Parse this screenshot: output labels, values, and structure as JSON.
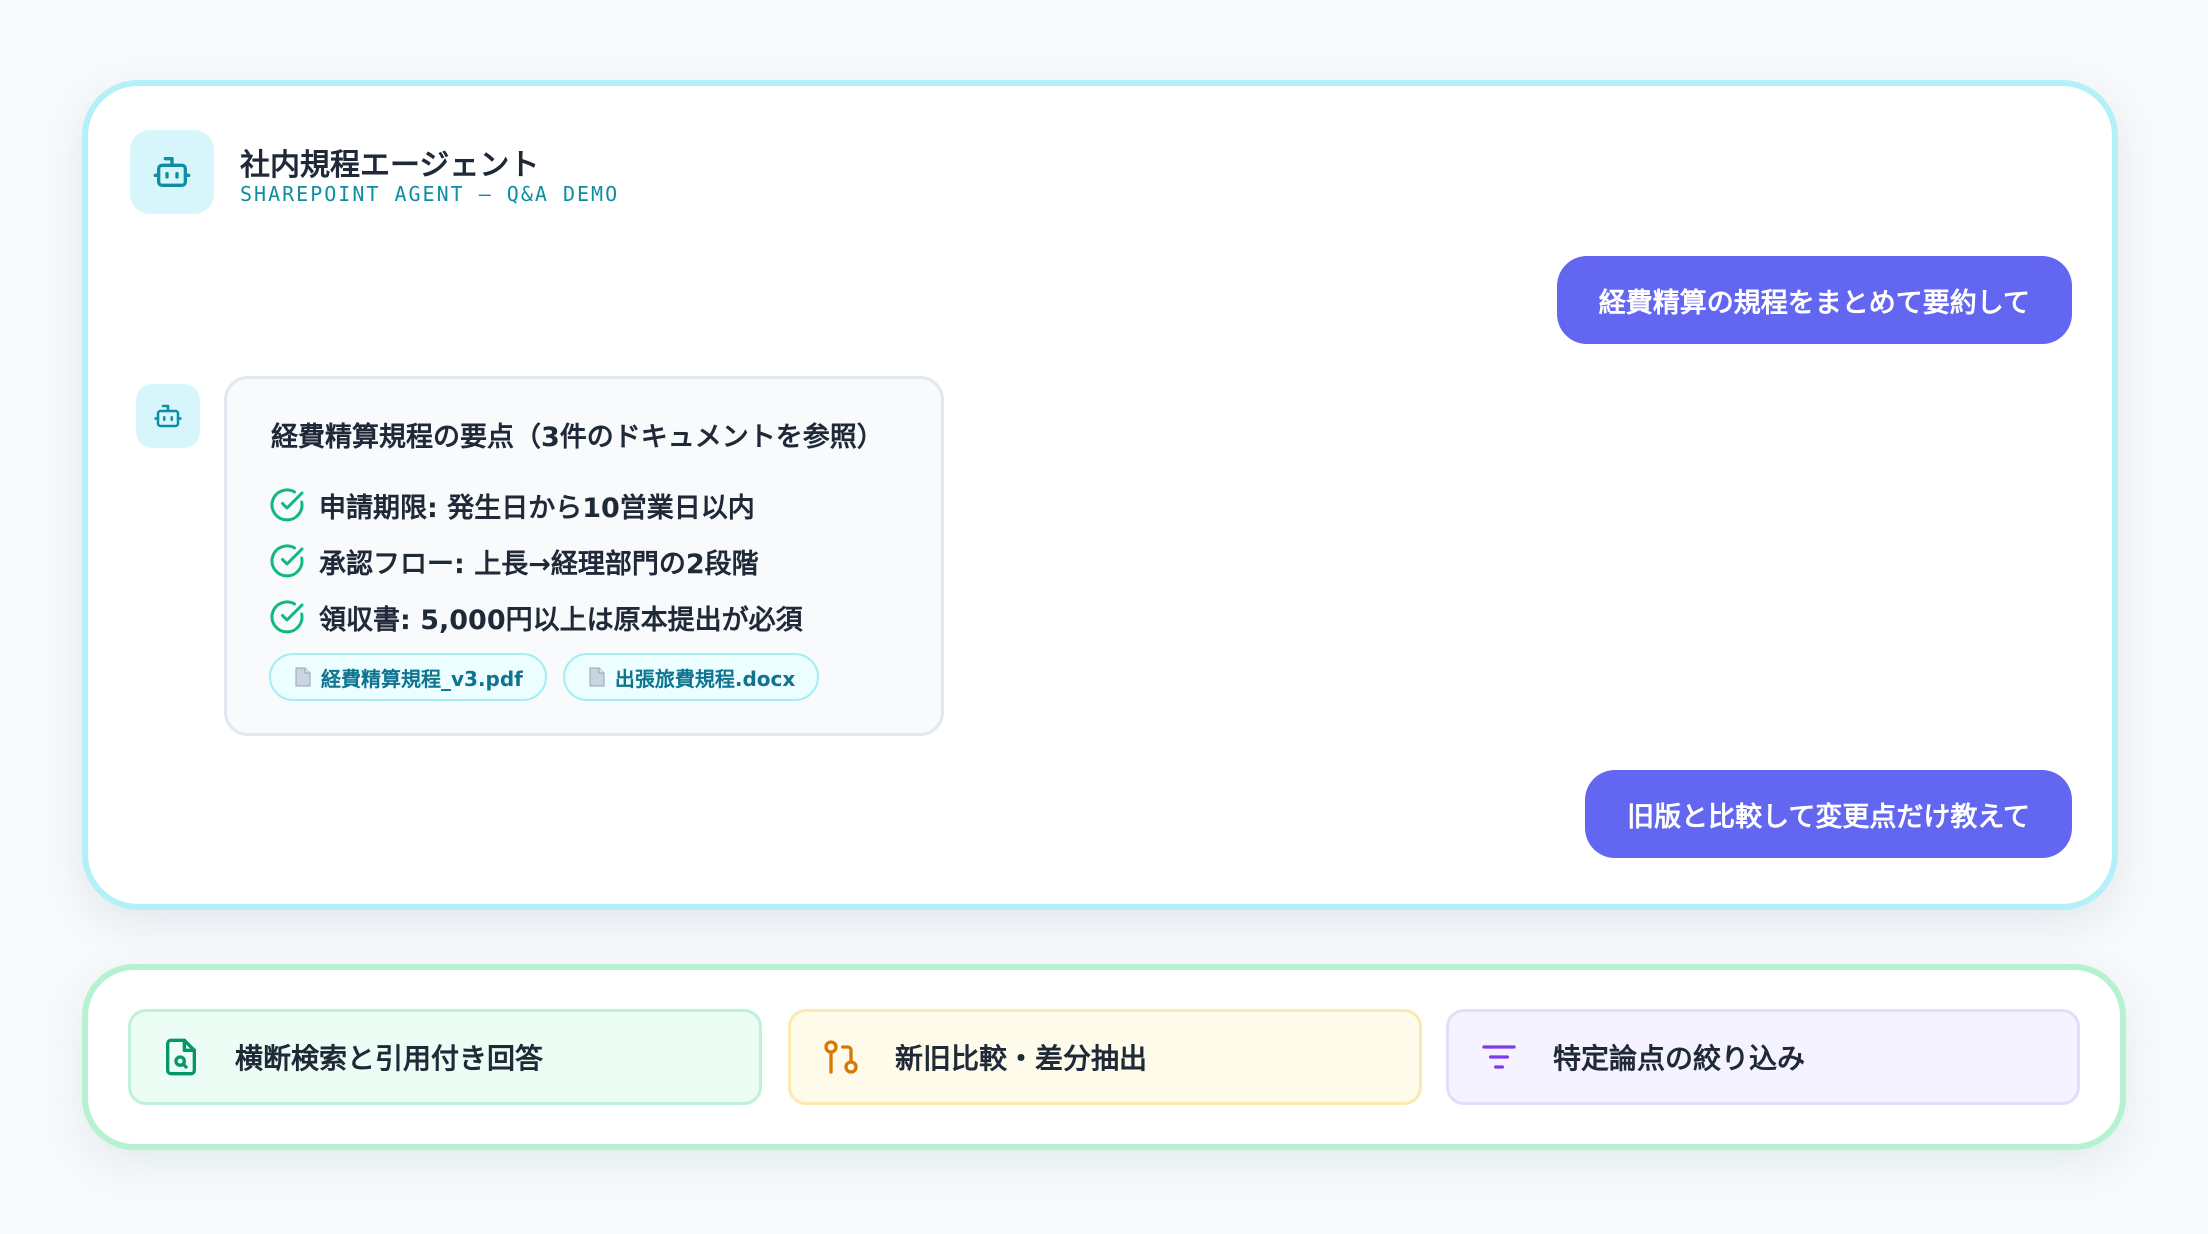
{
  "header": {
    "title": "社内規程エージェント",
    "subtitle": "SHAREPOINT AGENT — Q&A DEMO",
    "icon": "robot-icon"
  },
  "conversation": {
    "user_message_1": "経費精算の規程をまとめて要約して",
    "answer": {
      "title": "経費精算規程の要点（3件のドキュメントを参照）",
      "points": [
        "申請期限: 発生日から10営業日以内",
        "承認フロー: 上長→経理部門の2段階",
        "領収書: 5,000円以上は原本提出が必須"
      ],
      "sources": [
        "経費精算規程_v3.pdf",
        "出張旅費規程.docx"
      ]
    },
    "user_message_2": "旧版と比較して変更点だけ教えて"
  },
  "features": [
    {
      "label": "横断検索と引用付き回答",
      "icon": "document-search-icon",
      "color": "#059669"
    },
    {
      "label": "新旧比較・差分抽出",
      "icon": "git-compare-icon",
      "color": "#d97706"
    },
    {
      "label": "特定論点の絞り込み",
      "icon": "filter-icon",
      "color": "#7c3aed"
    }
  ],
  "colors": {
    "accent_cyan": "#0e8ea0",
    "user_bubble": "#6366f1",
    "check_green": "#10b981"
  }
}
